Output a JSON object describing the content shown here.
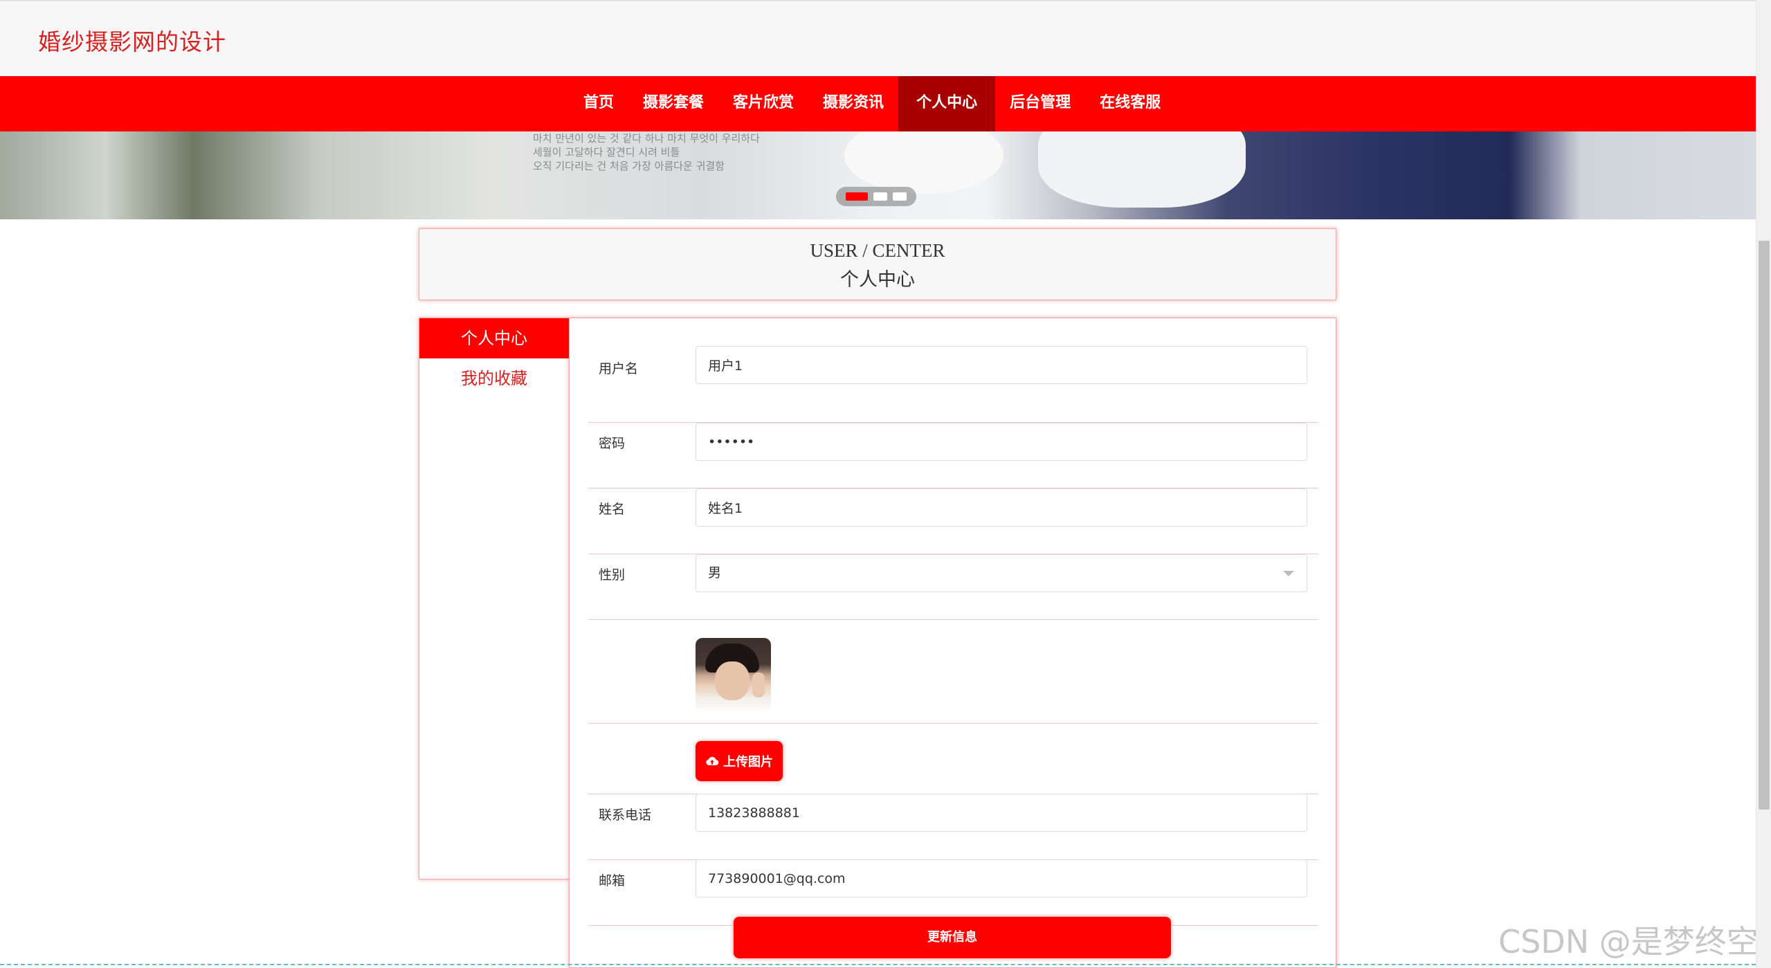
{
  "site": {
    "title": "婚纱摄影网的设计"
  },
  "nav": {
    "items": [
      {
        "label": "首页"
      },
      {
        "label": "摄影套餐"
      },
      {
        "label": "客片欣赏"
      },
      {
        "label": "摄影资讯"
      },
      {
        "label": "个人中心",
        "active": true
      },
      {
        "label": "后台管理"
      },
      {
        "label": "在线客服"
      }
    ]
  },
  "banner": {
    "text_lines": [
      "마치 만년이 있는 것 같다 하나 마치 무엇이 우리하다",
      "세월이 고달하다 잘견디 시려 비틀",
      "오직 기다리는 건 처음 가장 아름다운 귀결함"
    ],
    "carousel": {
      "slides": 3,
      "active": 1
    }
  },
  "section_title": {
    "en": "USER / CENTER",
    "zh": "个人中心"
  },
  "sidebar": {
    "items": [
      {
        "label": "个人中心",
        "active": true
      },
      {
        "label": "我的收藏"
      }
    ]
  },
  "form": {
    "username": {
      "label": "用户名",
      "value": "用户1"
    },
    "password": {
      "label": "密码",
      "value": "••••••"
    },
    "name": {
      "label": "姓名",
      "value": "姓名1"
    },
    "gender": {
      "label": "性别",
      "value": "男"
    },
    "upload_label": "上传图片",
    "phone": {
      "label": "联系电话",
      "value": "13823888881"
    },
    "email": {
      "label": "邮箱",
      "value": "773890001@qq.com"
    },
    "submit_label": "更新信息"
  },
  "watermark": "CSDN @是梦终空",
  "colors": {
    "accent": "#ff0000",
    "nav_active": "#a80000",
    "title_red": "#d62121"
  }
}
